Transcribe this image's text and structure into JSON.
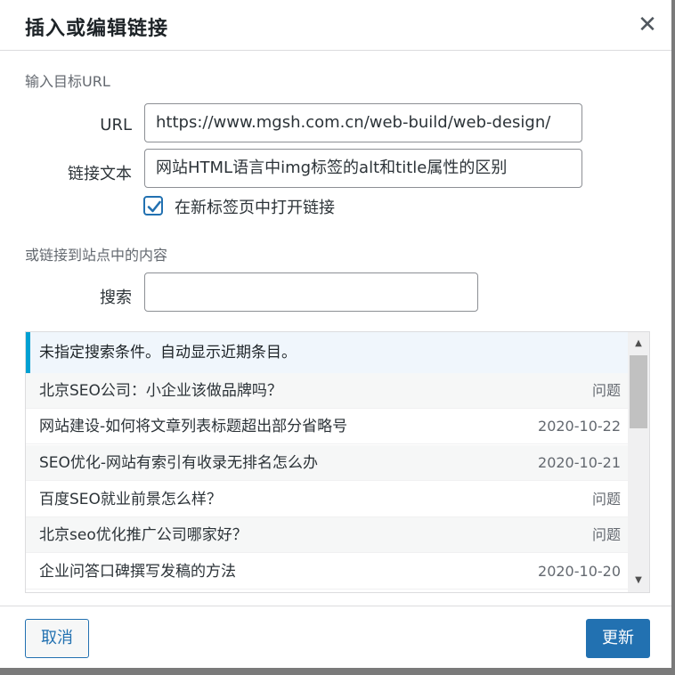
{
  "dialog": {
    "title": "插入或编辑链接",
    "close_icon": "close-icon"
  },
  "url_section": {
    "heading": "输入目标URL",
    "url_label": "URL",
    "url_value": "https://www.mgsh.com.cn/web-build/web-design/",
    "link_text_label": "链接文本",
    "link_text_value": "网站HTML语言中img标签的alt和title属性的区别",
    "new_tab_label": "在新标签页中打开链接",
    "new_tab_checked": true
  },
  "search_section": {
    "heading": "或链接到站点中的内容",
    "search_label": "搜索",
    "search_value": ""
  },
  "results": {
    "notice": "未指定搜索条件。自动显示近期条目。",
    "items": [
      {
        "title": "北京SEO公司：小企业该做品牌吗？",
        "info": "问题"
      },
      {
        "title": "网站建设-如何将文章列表标题超出部分省略号",
        "info": "2020-10-22"
      },
      {
        "title": "SEO优化-网站有索引有收录无排名怎么办",
        "info": "2020-10-21"
      },
      {
        "title": "百度SEO就业前景怎么样？",
        "info": "问题"
      },
      {
        "title": "北京seo优化推广公司哪家好？",
        "info": "问题"
      },
      {
        "title": "企业问答口碑撰写发稿的方法",
        "info": "2020-10-20"
      }
    ]
  },
  "footer": {
    "cancel_label": "取消",
    "update_label": "更新"
  },
  "colors": {
    "accent": "#2271b1",
    "notice_border": "#00a0d2"
  }
}
